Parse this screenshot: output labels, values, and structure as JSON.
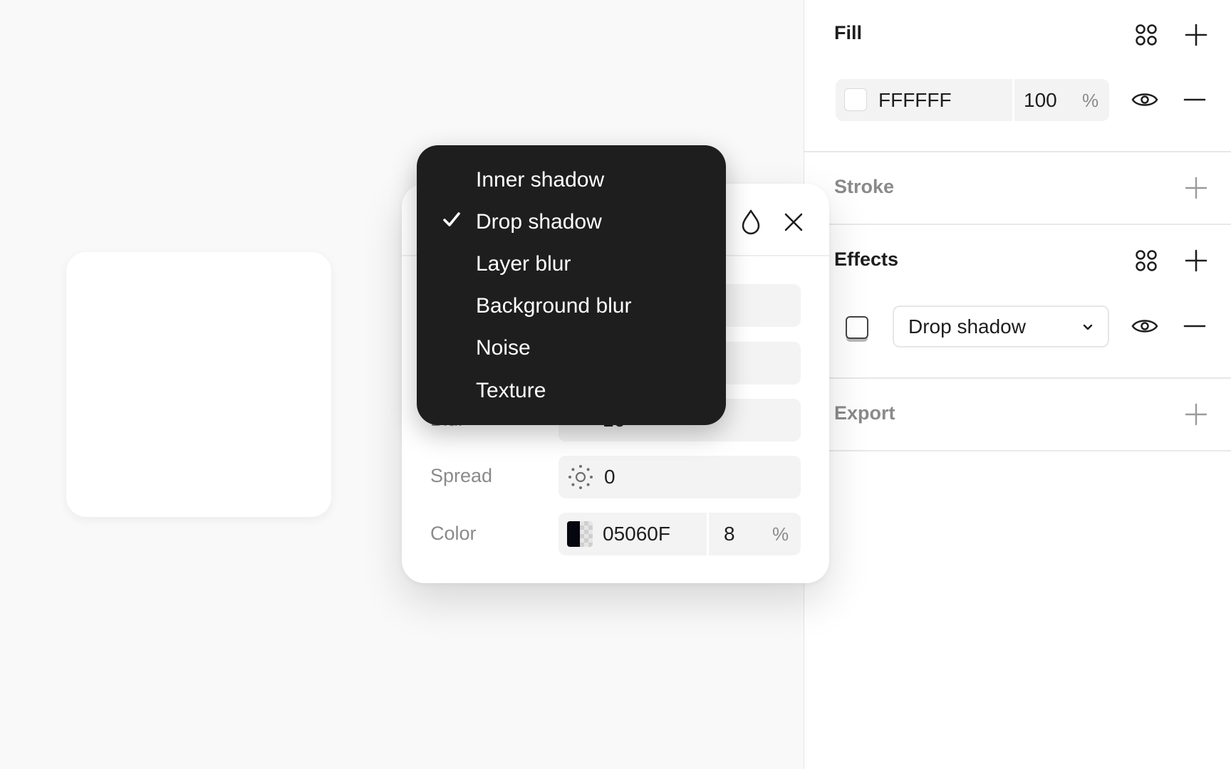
{
  "panel": {
    "fill": {
      "title": "Fill",
      "hex": "FFFFFF",
      "opacity": "100",
      "unit": "%",
      "icons": [
        "styles-grid-icon",
        "plus-icon",
        "eye-icon",
        "minus-icon"
      ]
    },
    "stroke": {
      "title": "Stroke"
    },
    "effects": {
      "title": "Effects",
      "selected_type": "Drop shadow"
    },
    "export": {
      "title": "Export"
    }
  },
  "popover": {
    "rows": [
      {
        "label": "Blur",
        "value": "16"
      },
      {
        "label": "Spread",
        "value": "0"
      }
    ],
    "color": {
      "label": "Color",
      "hex": "05060F",
      "opacity": "8",
      "unit": "%",
      "swatch": "#05060f"
    }
  },
  "menu": {
    "items": [
      {
        "label": "Inner shadow",
        "checked": false
      },
      {
        "label": "Drop shadow",
        "checked": true
      },
      {
        "label": "Layer blur",
        "checked": false
      },
      {
        "label": "Background blur",
        "checked": false
      },
      {
        "label": "Noise",
        "checked": false
      },
      {
        "label": "Texture",
        "checked": false
      }
    ]
  },
  "colors": {
    "menu_background": "#1e1e1e",
    "panel_background": "#ffffff",
    "canvas_background": "#f9f9f9",
    "field_background": "#f3f3f3"
  }
}
